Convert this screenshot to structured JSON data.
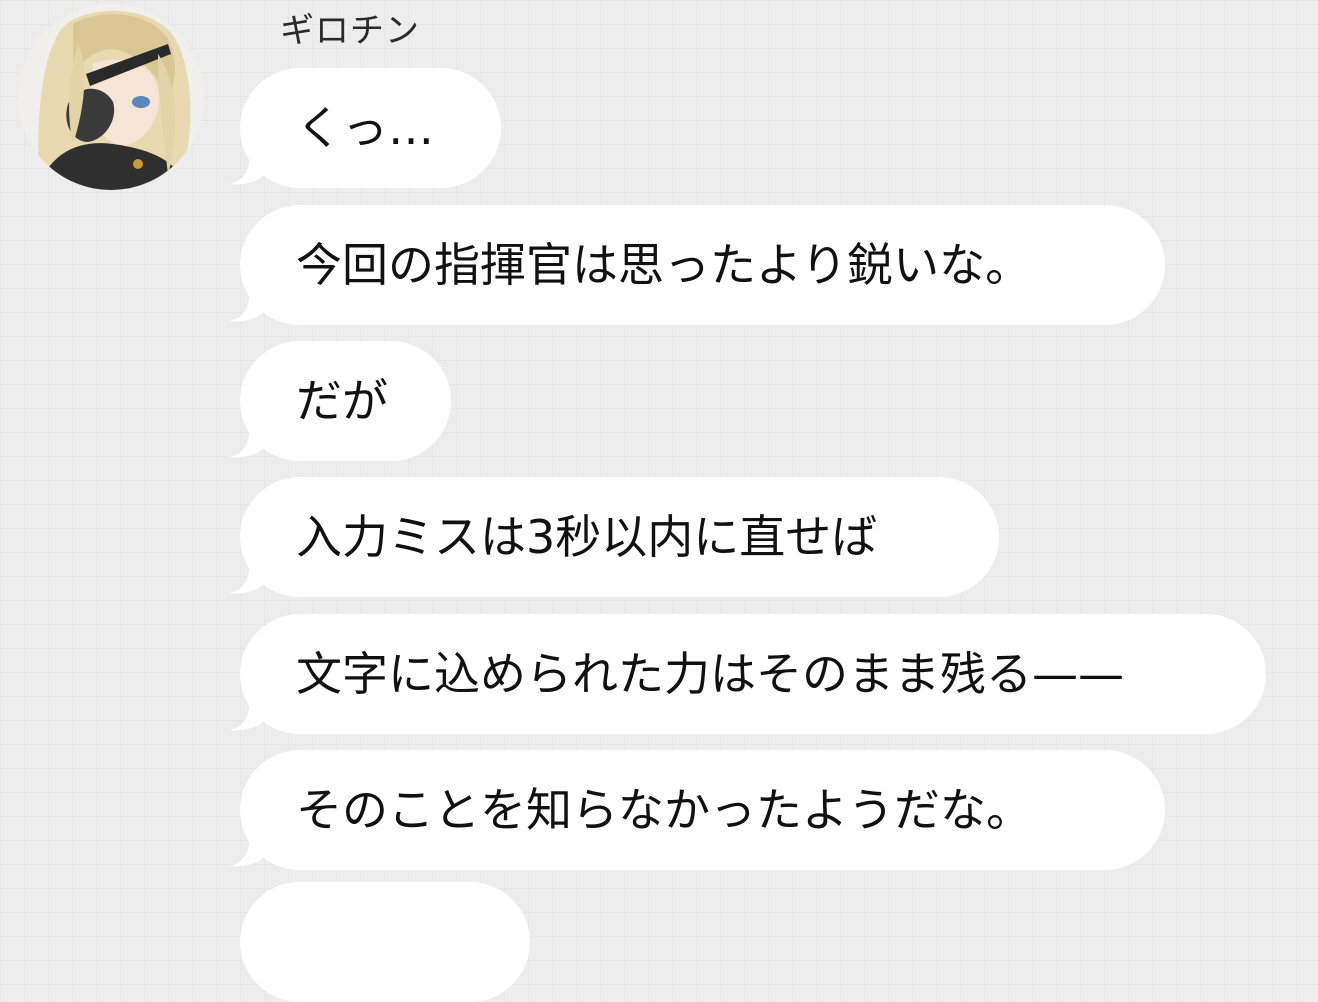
{
  "chat": {
    "sender": {
      "name": "ギロチン",
      "avatar": "character-portrait-avatar"
    },
    "messages": [
      {
        "text": "くっ…"
      },
      {
        "text": "今回の指揮官は思ったより鋭いな。"
      },
      {
        "text": "だが"
      },
      {
        "text": "入力ミスは3秒以内に直せば"
      },
      {
        "text": "文字に込められた力はそのまま残る——"
      },
      {
        "text": "そのことを知らなかったようだな。"
      }
    ]
  },
  "colors": {
    "background": "#ededed",
    "bubble": "#ffffff",
    "text": "#111111"
  }
}
